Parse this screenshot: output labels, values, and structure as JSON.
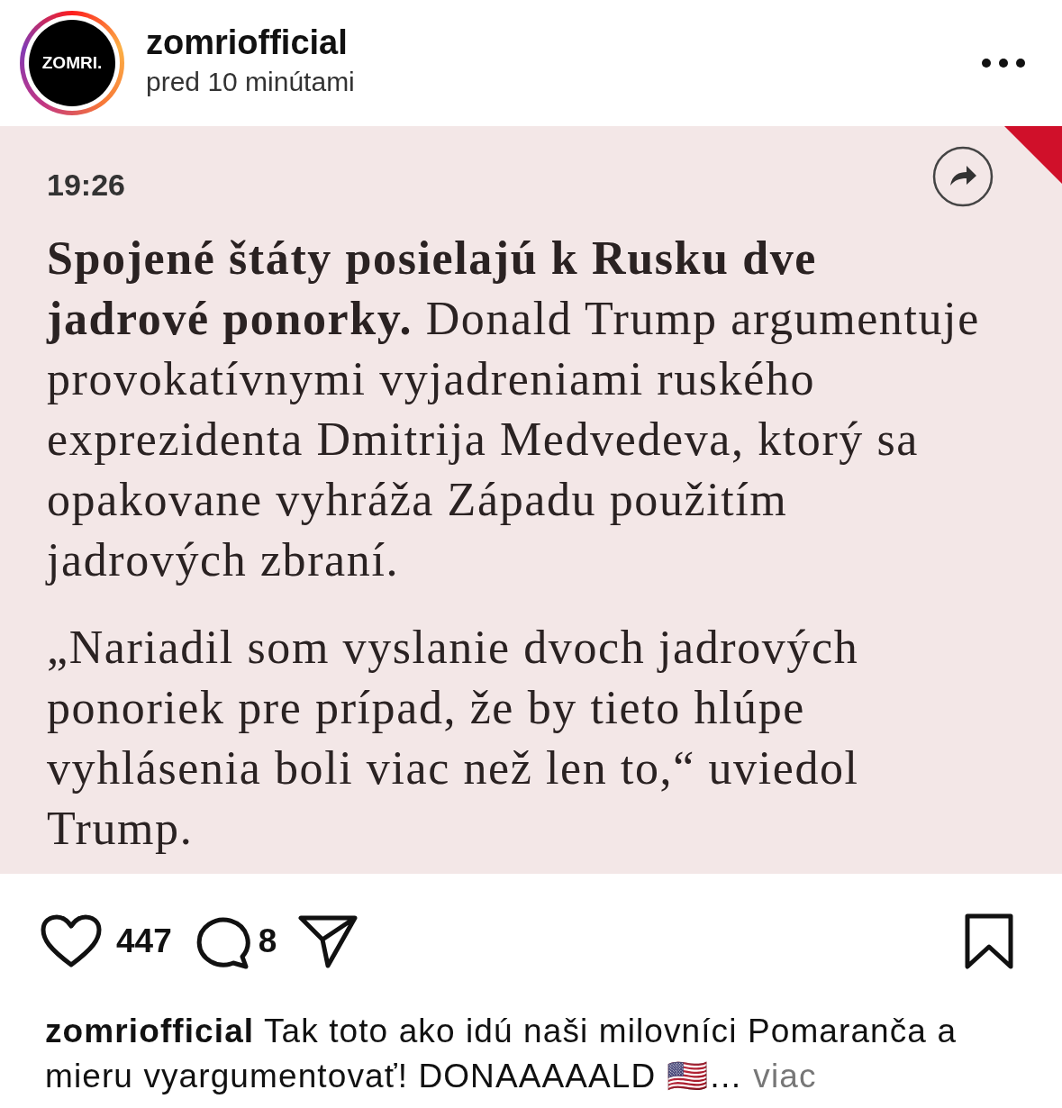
{
  "post": {
    "author": "zomriofficial",
    "time": "pred 10 minútami",
    "avatar_text": "ZOMRI."
  },
  "image": {
    "time": "19:26",
    "paragraphs": [
      "**Spojené štáty posielajú k Rusku dve jadrové ponorky.** Donald Trump argumentuje provokatívnymi vyjadreniami ruského exprezidenta Dmitrija Medvedeva, ktorý sa opakovane vyhráža Západu použitím jadrových zbraní.",
      "„Nariadil som vyslanie dvoch jadrových ponoriek pre prípad, že by tieto hlúpe vyhlásenia boli viac než len to,“ uviedol Trump."
    ]
  },
  "actions": {
    "likes": "447",
    "liked": false,
    "comments": "8",
    "saved": false
  },
  "caption": {
    "author": "zomriofficial",
    "text": "Tak toto ako idú naši milovníci Pomaranča a mieru vyargumentovať! DONAAAAALD 🇺🇸…",
    "more": "viac"
  }
}
